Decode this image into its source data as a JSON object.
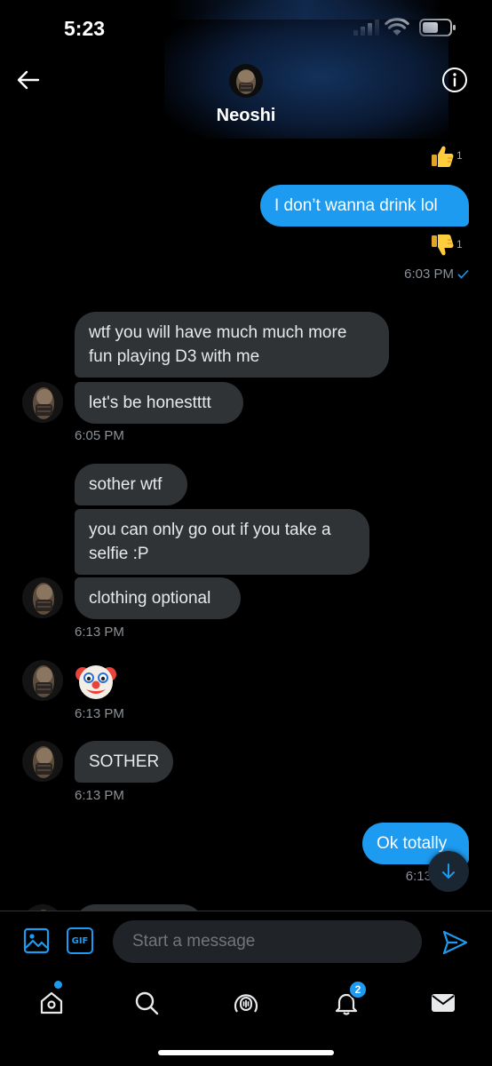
{
  "status_bar": {
    "time": "5:23"
  },
  "header": {
    "contact_name": "Neoshi",
    "back_icon": "arrow-left-icon",
    "info_icon": "info-icon"
  },
  "conversation": {
    "reaction_like": {
      "emoji": "thumbs-up",
      "count": "1"
    },
    "outgoing_1": {
      "text": "I don’t wanna drink lol"
    },
    "reaction_dislike": {
      "emoji": "thumbs-down",
      "count": "1"
    },
    "time_1": "6:03 PM",
    "group_1": {
      "messages": [
        "wtf you will have much much more fun playing D3 with me",
        "let's be honestttt"
      ],
      "time": "6:05 PM"
    },
    "group_2": {
      "messages": [
        "sother wtf",
        "you can only go out if you take a selfie :P",
        "clothing optional"
      ],
      "time": "6:13 PM"
    },
    "group_3": {
      "emoji": "clown-face",
      "time": "6:13 PM"
    },
    "group_4": {
      "messages": [
        "SOTHER"
      ],
      "time": "6:13 PM"
    },
    "outgoing_2": {
      "text": "Ok totally",
      "time": "6:13"
    }
  },
  "composer": {
    "placeholder": "Start a message",
    "gif_label": "GIF"
  },
  "tabbar": {
    "items": [
      "home",
      "search",
      "spaces",
      "notifications",
      "messages"
    ],
    "notifications_badge": "2"
  },
  "colors": {
    "accent": "#1d9bf0",
    "bubble_incoming": "#2f3336",
    "background": "#000000"
  }
}
